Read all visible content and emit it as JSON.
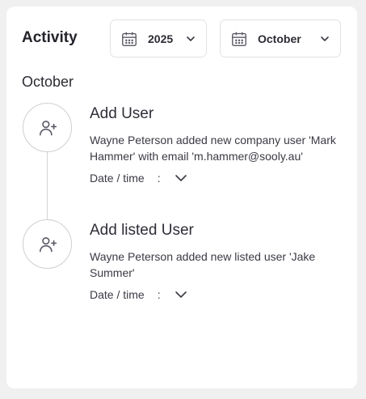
{
  "header": {
    "title": "Activity",
    "year_select": {
      "value": "2025",
      "icon": "calendar-icon"
    },
    "month_select": {
      "value": "October",
      "icon": "calendar-icon"
    }
  },
  "section_title": "October",
  "activities": [
    {
      "icon": "add-user-icon",
      "title": "Add User",
      "description": "Wayne Peterson added new company user 'Mark Hammer' with email 'm.hammer@sooly.au'",
      "meta_label": "Date / time",
      "meta_separator": ":"
    },
    {
      "icon": "add-user-icon",
      "title": "Add listed User",
      "description": "Wayne Peterson added new listed user 'Jake Summer'",
      "meta_label": "Date / time",
      "meta_separator": ":"
    }
  ],
  "colors": {
    "background": "#f0f0f0",
    "card": "#ffffff",
    "border": "#e2e2e6",
    "text": "#2e2e38",
    "icon": "#5a5a66"
  }
}
